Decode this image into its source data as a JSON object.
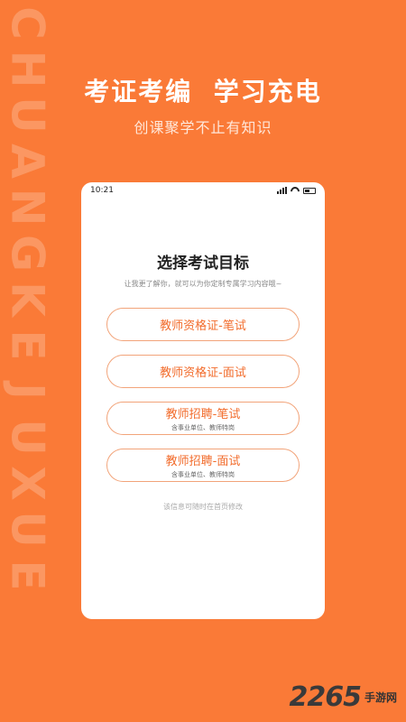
{
  "side_brand": {
    "text": "CHUANGKEJUXUE"
  },
  "header": {
    "headline": "考证考编  学习充电",
    "subline": "创课聚学不止有知识"
  },
  "phone": {
    "status_bar": {
      "time": "10:21"
    },
    "title": "选择考试目标",
    "description": "让我更了解你，就可以为你定制专属学习内容哦~",
    "options": [
      {
        "label": "教师资格证-笔试",
        "sub": ""
      },
      {
        "label": "教师资格证-面试",
        "sub": ""
      },
      {
        "label": "教师招聘-笔试",
        "sub": "含事业单位、教师特岗"
      },
      {
        "label": "教师招聘-面试",
        "sub": "含事业单位、教师特岗"
      }
    ],
    "footnote": "该信息可随时在首页修改"
  },
  "watermark": {
    "number": "2265",
    "text": "手游网"
  },
  "colors": {
    "background": "#FA7A37",
    "accent": "#F26C2C"
  }
}
